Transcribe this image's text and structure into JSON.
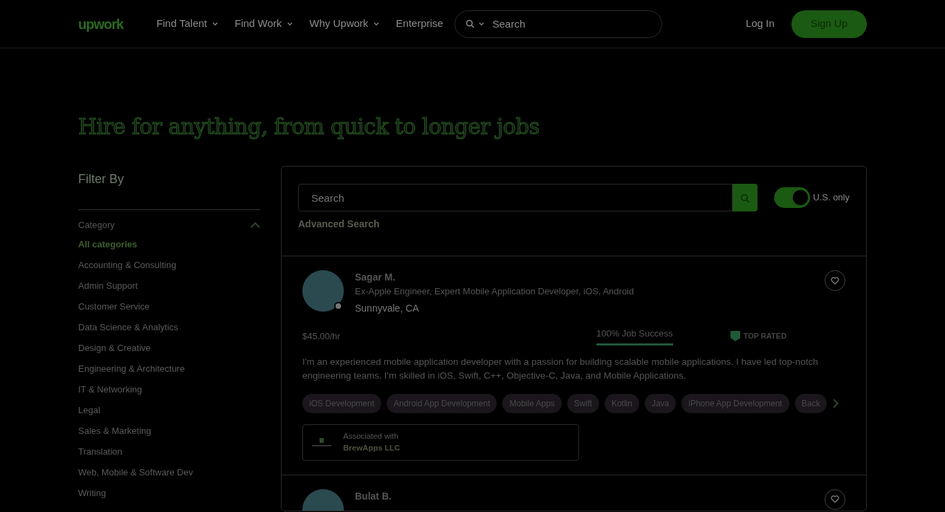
{
  "nav": {
    "logo": "upwork",
    "items": [
      {
        "label": "Find Talent",
        "dropdown": true
      },
      {
        "label": "Find Work",
        "dropdown": true
      },
      {
        "label": "Why Upwork",
        "dropdown": true
      },
      {
        "label": "Enterprise",
        "dropdown": false
      }
    ],
    "search": {
      "placeholder": "Search"
    },
    "login": "Log In",
    "signup": "Sign Up"
  },
  "headline": "Hire for anything, from quick to longer jobs",
  "filter": {
    "title": "Filter By",
    "category": {
      "label": "Category",
      "expanded": true
    },
    "items": [
      {
        "label": "All categories",
        "selected": true
      },
      {
        "label": "Accounting & Consulting",
        "selected": false
      },
      {
        "label": "Admin Support",
        "selected": false
      },
      {
        "label": "Customer Service",
        "selected": false
      },
      {
        "label": "Data Science & Analytics",
        "selected": false
      },
      {
        "label": "Design & Creative",
        "selected": false
      },
      {
        "label": "Engineering & Architecture",
        "selected": false
      },
      {
        "label": "IT & Networking",
        "selected": false
      },
      {
        "label": "Legal",
        "selected": false
      },
      {
        "label": "Sales & Marketing",
        "selected": false
      },
      {
        "label": "Translation",
        "selected": false
      },
      {
        "label": "Web, Mobile & Software Dev",
        "selected": false
      },
      {
        "label": "Writing",
        "selected": false
      }
    ]
  },
  "search_panel": {
    "placeholder": "Search",
    "advanced_search": "Advanced Search",
    "us_only": {
      "label": "U.S. only",
      "on": true
    }
  },
  "freelancers": [
    {
      "name": "Sagar M.",
      "title": "Ex-Apple Engineer, Expert Mobile Application Developer, iOS, Android",
      "location": "Sunnyvale, CA",
      "online": false,
      "rate": "$45.00/hr",
      "job_success": "100% Job Success",
      "badge": "TOP RATED",
      "description": "I'm an experienced mobile application developer with a passion for building scalable mobile applications. I have led top-notch engineering teams. I'm skilled in iOS, Swift, C++, Objective-C, Java, and Mobile Applications.",
      "skills": [
        "iOS Development",
        "Android App Development",
        "Mobile Apps",
        "Swift",
        "Kotlin",
        "Java",
        "iPhone App Development",
        "Back"
      ],
      "association": {
        "label": "Associated with",
        "company": "BrewApps LLC"
      }
    },
    {
      "name": "Bulat B."
    }
  ]
}
